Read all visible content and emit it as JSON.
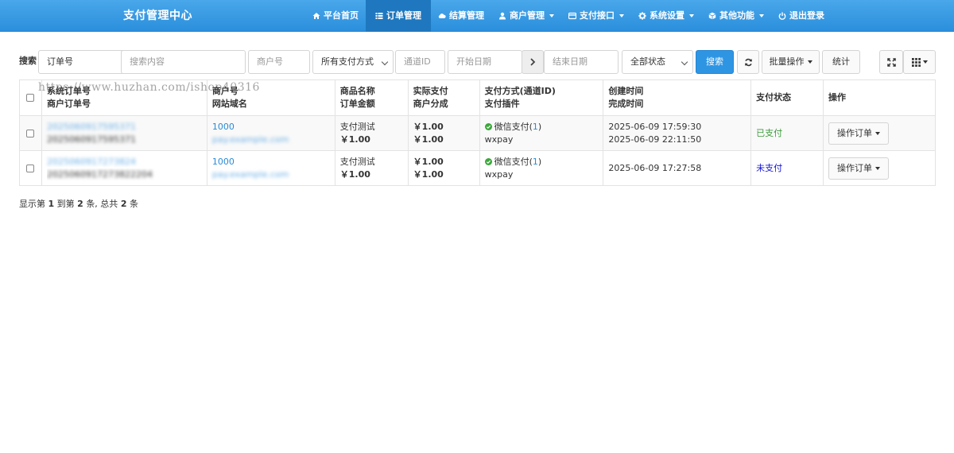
{
  "navbar": {
    "brand": "支付管理中心",
    "items": [
      {
        "label": "平台首页",
        "icon": "home-icon",
        "active": false,
        "dropdown": false
      },
      {
        "label": "订单管理",
        "icon": "list-icon",
        "active": true,
        "dropdown": false
      },
      {
        "label": "结算管理",
        "icon": "cloud-icon",
        "active": false,
        "dropdown": false
      },
      {
        "label": "商户管理",
        "icon": "user-icon",
        "active": false,
        "dropdown": true
      },
      {
        "label": "支付接口",
        "icon": "credit-card-icon",
        "active": false,
        "dropdown": true
      },
      {
        "label": "系统设置",
        "icon": "gear-icon",
        "active": false,
        "dropdown": true
      },
      {
        "label": "其他功能",
        "icon": "cube-icon",
        "active": false,
        "dropdown": true
      },
      {
        "label": "退出登录",
        "icon": "power-icon",
        "active": false,
        "dropdown": false
      }
    ]
  },
  "toolbar": {
    "search_label": "搜索",
    "field_select": "订单号",
    "search_placeholder": "搜索内容",
    "merchant_placeholder": "商户号",
    "paytype_select": "所有支付方式",
    "channel_placeholder": "通道ID",
    "start_placeholder": "开始日期",
    "end_placeholder": "结束日期",
    "status_select": "全部状态",
    "search_button": "搜索",
    "batch_button": "批量操作",
    "stats_button": "统计"
  },
  "table": {
    "headers": {
      "col1_line1": "系统订单号",
      "col1_line2": "商户订单号",
      "col2_line1": "商户号",
      "col2_line2": "网站域名",
      "col3_line1": "商品名称",
      "col3_line2": "订单金额",
      "col4_line1": "实际支付",
      "col4_line2": "商户分成",
      "col5_line1": "支付方式(通道ID)",
      "col5_line2": "支付插件",
      "col6_line1": "创建时间",
      "col6_line2": "完成时间",
      "col7": "支付状态",
      "col8": "操作"
    },
    "rows": [
      {
        "sys_order": "2025060917595371",
        "mch_order": "2025060917595371",
        "mch_id": "1000",
        "domain": "pay.example.com",
        "product": "支付测试",
        "amount": "￥1.00",
        "paid": "￥1.00",
        "share": "￥1.00",
        "pay_method": "微信支付",
        "channel_id": "1",
        "plugin": "wxpay",
        "created": "2025-06-09 17:59:30",
        "completed": "2025-06-09 22:11:50",
        "status": "已支付",
        "op_label": "操作订单"
      },
      {
        "sys_order": "2025060917273824",
        "mch_order": "2025060917273822204",
        "mch_id": "1000",
        "domain": "pay.example.com",
        "product": "支付测试",
        "amount": "￥1.00",
        "paid": "￥1.00",
        "share": "￥1.00",
        "pay_method": "微信支付",
        "channel_id": "1",
        "plugin": "wxpay",
        "created": "2025-06-09 17:27:58",
        "completed": "",
        "status": "未支付",
        "op_label": "操作订单"
      }
    ]
  },
  "pagination": {
    "prefix": "显示第",
    "from": "1",
    "to_text": "到第",
    "to": "2",
    "mid": "条, 总共",
    "total": "2",
    "suffix": "条"
  },
  "watermark": "https://www.huzhan.com/ishop40316",
  "colors": {
    "navbar": "#2b8fdc",
    "nav_active": "#1f78bf",
    "primary": "#2e95e3",
    "paid": "#3c9a3c",
    "unpaid": "#1515d5",
    "link": "#2a8bd6"
  }
}
